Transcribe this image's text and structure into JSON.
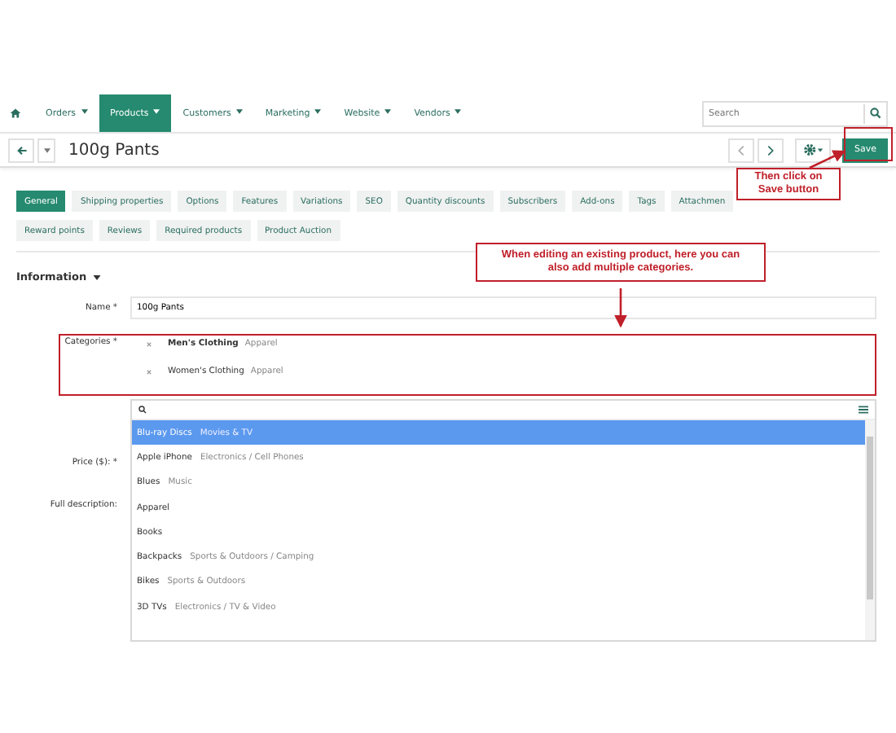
{
  "nav": {
    "items": [
      {
        "label": "Orders",
        "selected": false
      },
      {
        "label": "Products",
        "selected": true
      },
      {
        "label": "Customers",
        "selected": false
      },
      {
        "label": "Marketing",
        "selected": false
      },
      {
        "label": "Website",
        "selected": false
      },
      {
        "label": "Vendors",
        "selected": false
      }
    ],
    "search": {
      "placeholder": "Search"
    }
  },
  "title": "100g Pants",
  "save": "Save",
  "tabs": [
    {
      "label": "General",
      "selected": true
    },
    {
      "label": "Shipping properties",
      "selected": false
    },
    {
      "label": "Options",
      "selected": false
    },
    {
      "label": "Features",
      "selected": false
    },
    {
      "label": "Variations",
      "selected": false
    },
    {
      "label": "SEO",
      "selected": false
    },
    {
      "label": "Quantity discounts",
      "selected": false
    },
    {
      "label": "Subscribers",
      "selected": false
    },
    {
      "label": "Add-ons",
      "selected": false
    },
    {
      "label": "Tags",
      "selected": false
    },
    {
      "label": "Attachmen",
      "selected": false
    },
    {
      "label": "Reward points",
      "selected": false
    },
    {
      "label": "Reviews",
      "selected": false
    },
    {
      "label": "Required products",
      "selected": false
    },
    {
      "label": "Product Auction",
      "selected": false
    }
  ],
  "section": "Information",
  "name_field": {
    "label": "Name *",
    "value": "100g Pants"
  },
  "categories": {
    "label": "Categories *",
    "items": [
      {
        "name": "Men's Clothing",
        "path": "Apparel",
        "main": true
      },
      {
        "name": "Women's Clothing",
        "path": "Apparel",
        "main": false
      }
    ]
  },
  "labels": [
    "Price ($): *",
    "Full description:"
  ],
  "dropdown": {
    "items": [
      {
        "name": "Blu-ray Discs",
        "path": "Movies & TV",
        "selected": true
      },
      {
        "name": "Apple iPhone",
        "path": "Electronics / Cell Phones",
        "selected": false
      },
      {
        "name": "Blues",
        "path": "Music",
        "selected": false
      },
      {
        "name": "Apparel",
        "selected": false
      },
      {
        "name": "Books",
        "selected": false
      },
      {
        "name": "Backpacks",
        "path": "Sports & Outdoors / Camping",
        "selected": false
      },
      {
        "name": "Bikes",
        "path": "Sports & Outdoors",
        "selected": false
      },
      {
        "name": "3D TVs",
        "path": "Electronics / TV & Video",
        "selected": false
      }
    ]
  },
  "callouts": [
    "Then click on Save button",
    "When editing an existing product, here you can also add multiple categories."
  ]
}
